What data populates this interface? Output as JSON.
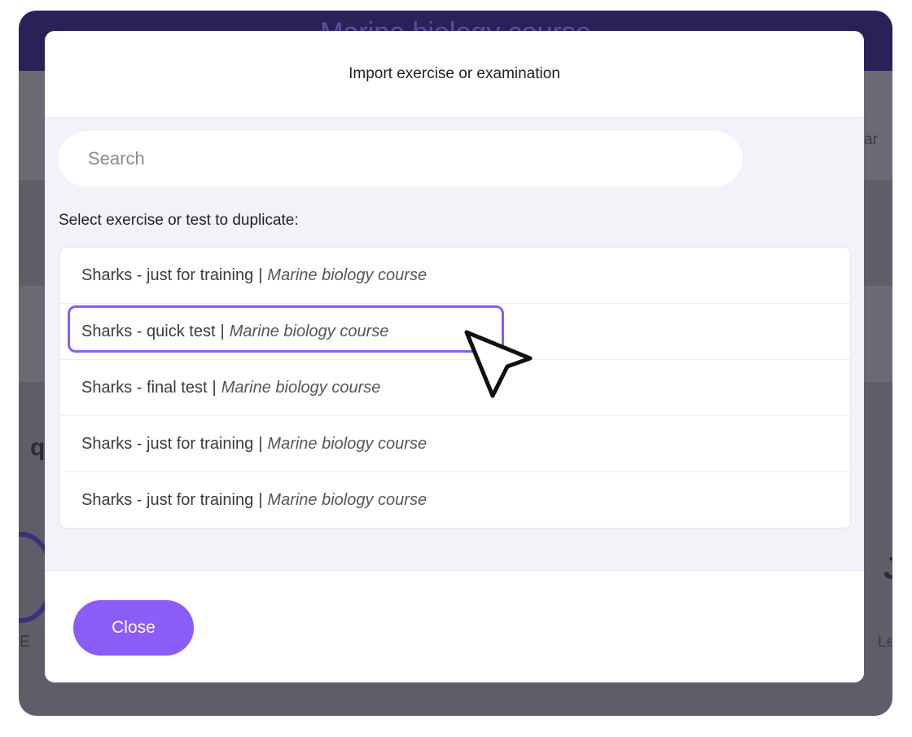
{
  "background": {
    "header_title": "Marine biology course",
    "fragments": {
      "right_tab": "ar",
      "left_heading": "q",
      "left_label": "E",
      "right_label": "Le",
      "right_number": "J"
    }
  },
  "modal": {
    "title": "Import exercise or examination",
    "search": {
      "placeholder": "Search",
      "value": ""
    },
    "select_label": "Select exercise or test to duplicate:",
    "items": [
      {
        "name": "Sharks - just for training",
        "separator": "|",
        "course": "Marine biology course"
      },
      {
        "name": "Sharks - quick test",
        "separator": "|",
        "course": "Marine biology course"
      },
      {
        "name": "Sharks - final test",
        "separator": "|",
        "course": "Marine biology course"
      },
      {
        "name": "Sharks - just for training",
        "separator": "|",
        "course": "Marine biology course"
      },
      {
        "name": "Sharks - just for training",
        "separator": "|",
        "course": "Marine biology course"
      }
    ],
    "close_label": "Close"
  },
  "colors": {
    "accent": "#8b5cf6",
    "app_header": "#2a2159",
    "panel": "#f2f2f9"
  },
  "icons": {
    "pointer": "cursor-arrow-icon"
  }
}
